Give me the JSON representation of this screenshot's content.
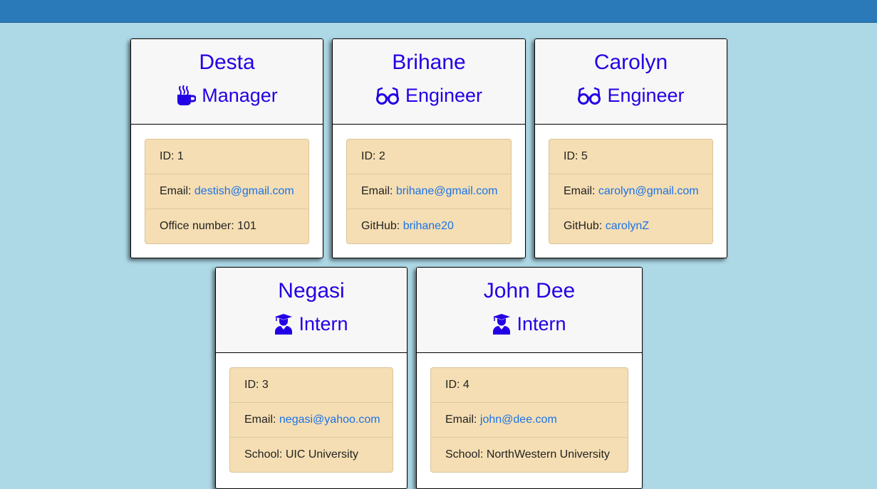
{
  "cards": [
    {
      "name": "Desta",
      "role": "Manager",
      "role_icon": "coffee-icon",
      "id_label": "ID: ",
      "id": "1",
      "email_label": "Email: ",
      "email": "destish@gmail.com",
      "extra_label": "Office number: ",
      "extra_value": "101"
    },
    {
      "name": "Brihane",
      "role": "Engineer",
      "role_icon": "glasses-icon",
      "id_label": "ID: ",
      "id": "2",
      "email_label": "Email: ",
      "email": "brihane@gmail.com",
      "extra_label": "GitHub: ",
      "extra_value": "brihane20"
    },
    {
      "name": "Carolyn",
      "role": "Engineer",
      "role_icon": "glasses-icon",
      "id_label": "ID: ",
      "id": "5",
      "email_label": "Email: ",
      "email": "carolyn@gmail.com",
      "extra_label": "GitHub: ",
      "extra_value": "carolynZ"
    },
    {
      "name": "Negasi",
      "role": "Intern",
      "role_icon": "graduate-icon",
      "id_label": "ID: ",
      "id": "3",
      "email_label": "Email: ",
      "email": "negasi@yahoo.com",
      "extra_label": "School: ",
      "extra_value": "UIC University"
    },
    {
      "name": "John Dee",
      "role": "Intern",
      "role_icon": "graduate-icon",
      "id_label": "ID: ",
      "id": "4",
      "email_label": "Email: ",
      "email": "john@dee.com",
      "extra_label": "School: ",
      "extra_value": "NorthWestern University"
    }
  ],
  "colors": {
    "background": "#add8e6",
    "topbar": "#2a7aba",
    "header_text": "#2200e6",
    "info_bg": "#f5deb3",
    "link": "#1a73e8"
  }
}
